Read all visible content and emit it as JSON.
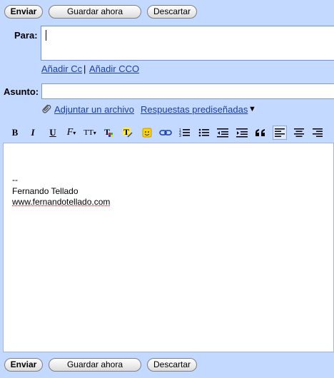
{
  "top_actions": {
    "send": "Enviar",
    "save": "Guardar ahora",
    "discard": "Descartar"
  },
  "bottom_actions": {
    "send": "Enviar",
    "save": "Guardar ahora",
    "discard": "Descartar"
  },
  "to": {
    "label": "Para:",
    "value": ""
  },
  "cc_links": {
    "add_cc": "Añadir Cc",
    "separator": "|",
    "add_bcc": "Añadir CCO"
  },
  "subject": {
    "label": "Asunto:",
    "value": ""
  },
  "attach": {
    "label": "Adjuntar un archivo"
  },
  "canned": {
    "label": "Respuestas prediseñadas",
    "arrow": "▼"
  },
  "toolbar": {
    "bold": "B",
    "italic": "I",
    "underline": "U",
    "font": "F",
    "size": "TT",
    "text_color": "T",
    "highlight": "T",
    "buttons": [
      "bold-icon",
      "italic-icon",
      "underline-icon",
      "font-icon",
      "font-size-icon",
      "text-color-icon",
      "highlight-icon",
      "emoticon-icon",
      "link-icon",
      "numbered-list-icon",
      "bullet-list-icon",
      "outdent-icon",
      "indent-icon",
      "quote-icon",
      "align-left-icon",
      "align-center-icon",
      "align-right-icon"
    ],
    "selected": "align-left-icon"
  },
  "body": {
    "dashes": "--",
    "name": "Fernando Tellado",
    "website": "www.fernandotellado.com"
  },
  "colors": {
    "background": "#c3d9ff",
    "link": "#1a3ea3"
  }
}
